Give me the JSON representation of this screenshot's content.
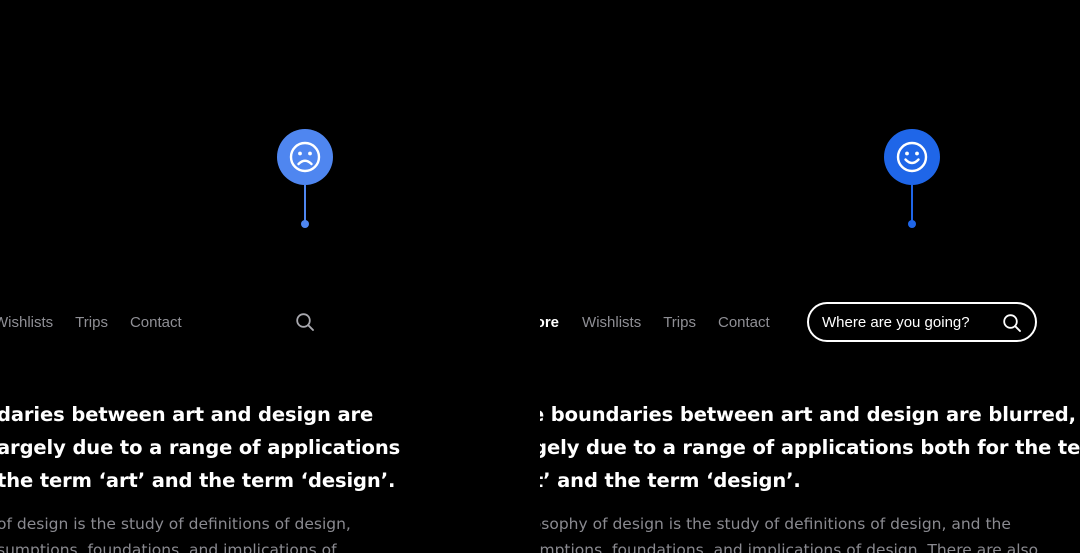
{
  "colors": {
    "background": "#000000",
    "marker_bad": "#4f86f0",
    "marker_good": "#1f66e8",
    "nav_text": "#8f8f95",
    "active_text": "#ffffff",
    "body_text": "#8a8a90"
  },
  "left": {
    "marker_icon": "sad-face-icon",
    "nav": {
      "items": [
        "Wishlists",
        "Trips",
        "Contact"
      ]
    },
    "search_icon": "search-icon",
    "headline_lines": [
      "daries between art and design are",
      "argely due to a range of applications",
      "the term ‘art’ and the term ‘design’."
    ],
    "body_lines": [
      "of design is the study of definitions of design,",
      "sumptions, foundations, and implications of"
    ]
  },
  "right": {
    "marker_icon": "happy-face-icon",
    "nav": {
      "active": "Explore",
      "items": [
        "Wishlists",
        "Trips",
        "Contact"
      ]
    },
    "search": {
      "placeholder": "Where are you going?",
      "icon": "search-icon"
    },
    "headline_lines": [
      "The boundaries between art and design are blurred,",
      "largely due to a range of applications both for the term",
      "‘art’ and the term ‘design’."
    ],
    "body_lines": [
      "Philosophy of design is the study of definitions of design, and the",
      "assumptions, foundations, and implications of design. There are also"
    ]
  }
}
